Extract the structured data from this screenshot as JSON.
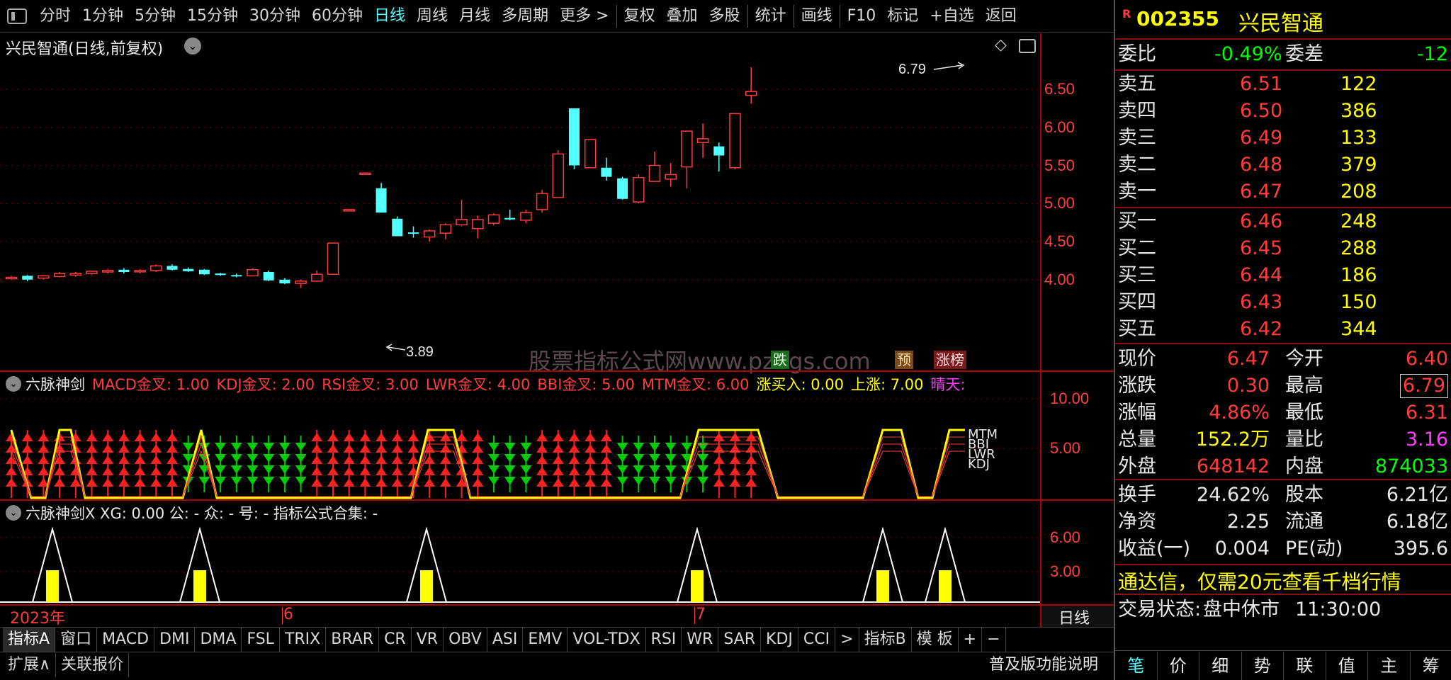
{
  "toolbar": {
    "items": [
      "分时",
      "1分钟",
      "5分钟",
      "15分钟",
      "30分钟",
      "60分钟",
      "日线",
      "周线",
      "月线",
      "多周期",
      "更多 >",
      "复权",
      "叠加",
      "多股",
      "统计",
      "画线",
      "F10",
      "标记",
      "+自选",
      "返回"
    ],
    "active_index": 6
  },
  "main_chart": {
    "title": "兴民智通(日线,前复权)",
    "high_marker": "6.79",
    "low_marker": "3.89",
    "watermark": "股票指标公式网www.pzbgs.com",
    "badges": [
      "跌",
      "预",
      "涨榜"
    ],
    "y_ticks": [
      "6.50",
      "6.00",
      "5.50",
      "5.00",
      "4.50",
      "4.00"
    ],
    "candles": [
      [
        4.02,
        4.05,
        4.0,
        4.03
      ],
      [
        4.05,
        4.06,
        3.98,
        4.0
      ],
      [
        4.02,
        4.06,
        4.0,
        4.05
      ],
      [
        4.04,
        4.1,
        4.03,
        4.08
      ],
      [
        4.06,
        4.1,
        4.04,
        4.08
      ],
      [
        4.08,
        4.12,
        4.06,
        4.11
      ],
      [
        4.1,
        4.14,
        4.08,
        4.12
      ],
      [
        4.13,
        4.15,
        4.08,
        4.1
      ],
      [
        4.11,
        4.14,
        4.08,
        4.12
      ],
      [
        4.12,
        4.2,
        4.1,
        4.18
      ],
      [
        4.18,
        4.2,
        4.12,
        4.13
      ],
      [
        4.14,
        4.16,
        4.1,
        4.11
      ],
      [
        4.13,
        4.14,
        4.06,
        4.07
      ],
      [
        4.08,
        4.09,
        4.05,
        4.06
      ],
      [
        4.06,
        4.08,
        4.03,
        4.05
      ],
      [
        4.05,
        4.15,
        4.04,
        4.13
      ],
      [
        4.1,
        4.12,
        3.98,
        3.99
      ],
      [
        4.0,
        4.02,
        3.94,
        3.95
      ],
      [
        3.95,
        4.0,
        3.89,
        3.98
      ],
      [
        3.98,
        4.12,
        3.97,
        4.07
      ],
      [
        4.07,
        4.48,
        4.06,
        4.48
      ],
      [
        4.92,
        4.92,
        4.92,
        4.92
      ],
      [
        5.4,
        5.4,
        5.4,
        5.4
      ],
      [
        5.2,
        5.27,
        4.88,
        4.88
      ],
      [
        4.8,
        4.83,
        4.57,
        4.57
      ],
      [
        4.62,
        4.7,
        4.55,
        4.61
      ],
      [
        4.56,
        4.66,
        4.5,
        4.64
      ],
      [
        4.61,
        4.74,
        4.53,
        4.72
      ],
      [
        4.72,
        5.05,
        4.7,
        4.79
      ],
      [
        4.67,
        4.84,
        4.54,
        4.79
      ],
      [
        4.74,
        4.87,
        4.71,
        4.85
      ],
      [
        4.81,
        4.92,
        4.78,
        4.79
      ],
      [
        4.78,
        4.92,
        4.74,
        4.88
      ],
      [
        4.92,
        5.18,
        4.88,
        5.13
      ],
      [
        5.08,
        5.7,
        5.08,
        5.65
      ],
      [
        6.25,
        6.25,
        5.45,
        5.5
      ],
      [
        5.47,
        5.84,
        5.47,
        5.84
      ],
      [
        5.47,
        5.6,
        5.3,
        5.35
      ],
      [
        5.33,
        5.35,
        5.05,
        5.06
      ],
      [
        5.02,
        5.38,
        5.0,
        5.34
      ],
      [
        5.29,
        5.68,
        5.29,
        5.5
      ],
      [
        5.32,
        5.53,
        5.22,
        5.38
      ],
      [
        5.48,
        5.92,
        5.2,
        5.95
      ],
      [
        5.8,
        6.05,
        5.6,
        5.85
      ],
      [
        5.75,
        5.8,
        5.42,
        5.63
      ],
      [
        5.47,
        6.18,
        5.45,
        6.18
      ],
      [
        6.42,
        6.79,
        6.31,
        6.47
      ]
    ]
  },
  "indicator1": {
    "title": "六脉神剑",
    "legend": [
      {
        "text": "MACD金叉: 1.00",
        "color": "#ff3b3b"
      },
      {
        "text": "KDJ金叉: 2.00",
        "color": "#ff3b3b"
      },
      {
        "text": "RSI金叉: 3.00",
        "color": "#ff3b3b"
      },
      {
        "text": "LWR金叉: 4.00",
        "color": "#ff3b3b"
      },
      {
        "text": "BBI金叉: 5.00",
        "color": "#ff3b3b"
      },
      {
        "text": "MTM金叉: 6.00",
        "color": "#ff3b3b"
      },
      {
        "text": "涨买入: 0.00",
        "color": "#ffff00"
      },
      {
        "text": "上涨: 7.00",
        "color": "#ffff00"
      },
      {
        "text": "晴天:",
        "color": "#ff3cff"
      }
    ],
    "y_ticks": [
      "10.00",
      "5.00"
    ],
    "side_labels": [
      "MTM",
      "BBI",
      "LWR",
      "KDJ"
    ]
  },
  "indicator2": {
    "title": "六脉神剑X XG: 0.00 公: - 众: - 号: - 指标公式合集: -",
    "y_ticks": [
      "6.00",
      "3.00"
    ]
  },
  "date_axis": {
    "labels": [
      "2023年",
      "6",
      "7"
    ],
    "period": "日线"
  },
  "bottom_tabs": [
    "指标A",
    "窗口",
    "MACD",
    "DMI",
    "DMA",
    "FSL",
    "TRIX",
    "BRAR",
    "CR",
    "VR",
    "OBV",
    "ASI",
    "EMV",
    "VOL-TDX",
    "RSI",
    "WR",
    "SAR",
    "KDJ",
    "CCI",
    ">",
    "指标B",
    "模 板",
    "+",
    "−"
  ],
  "status_tabs": [
    "扩展∧",
    "关联报价"
  ],
  "status_right": "普及版功能说明",
  "quote": {
    "code": "002355",
    "name": "兴民智通",
    "wei_bi_label": "委比",
    "wei_bi": "-0.49%",
    "wei_cha_label": "委差",
    "wei_cha": "-12",
    "asks": [
      {
        "label": "卖五",
        "price": "6.51",
        "vol": "122"
      },
      {
        "label": "卖四",
        "price": "6.50",
        "vol": "386"
      },
      {
        "label": "卖三",
        "price": "6.49",
        "vol": "133"
      },
      {
        "label": "卖二",
        "price": "6.48",
        "vol": "379"
      },
      {
        "label": "卖一",
        "price": "6.47",
        "vol": "208"
      }
    ],
    "bids": [
      {
        "label": "买一",
        "price": "6.46",
        "vol": "248"
      },
      {
        "label": "买二",
        "price": "6.45",
        "vol": "288"
      },
      {
        "label": "买三",
        "price": "6.44",
        "vol": "186"
      },
      {
        "label": "买四",
        "price": "6.43",
        "vol": "150"
      },
      {
        "label": "买五",
        "price": "6.42",
        "vol": "344"
      }
    ],
    "stats": [
      {
        "l1": "现价",
        "v1": "6.47",
        "c1": "#ff3b3b",
        "l2": "今开",
        "v2": "6.40",
        "c2": "#ff3b3b"
      },
      {
        "l1": "涨跌",
        "v1": "0.30",
        "c1": "#ff3b3b",
        "l2": "最高",
        "v2": "6.79",
        "c2": "#ff3b3b"
      },
      {
        "l1": "涨幅",
        "v1": "4.86%",
        "c1": "#ff3b3b",
        "l2": "最低",
        "v2": "6.31",
        "c2": "#ff3b3b"
      },
      {
        "l1": "总量",
        "v1": "152.2万",
        "c1": "#ffff00",
        "l2": "量比",
        "v2": "3.16",
        "c2": "#ff3cff"
      },
      {
        "l1": "外盘",
        "v1": "648142",
        "c1": "#ff3b3b",
        "l2": "内盘",
        "v2": "874033",
        "c2": "#00ff00"
      }
    ],
    "fund": [
      {
        "l1": "换手",
        "v1": "24.62%",
        "l2": "股本",
        "v2": "6.21亿"
      },
      {
        "l1": "净资",
        "v1": "2.25",
        "l2": "流通",
        "v2": "6.18亿"
      },
      {
        "l1": "收益(一)",
        "v1": "0.004",
        "l2": "PE(动)",
        "v2": "395.6"
      }
    ],
    "promo": "通达信，仅需20元查看千档行情",
    "status_label": "交易状态:",
    "status_text": "盘中休市",
    "status_time": "11:30:00",
    "tabs": [
      "笔",
      "价",
      "细",
      "势",
      "联",
      "值",
      "主",
      "筹"
    ]
  }
}
